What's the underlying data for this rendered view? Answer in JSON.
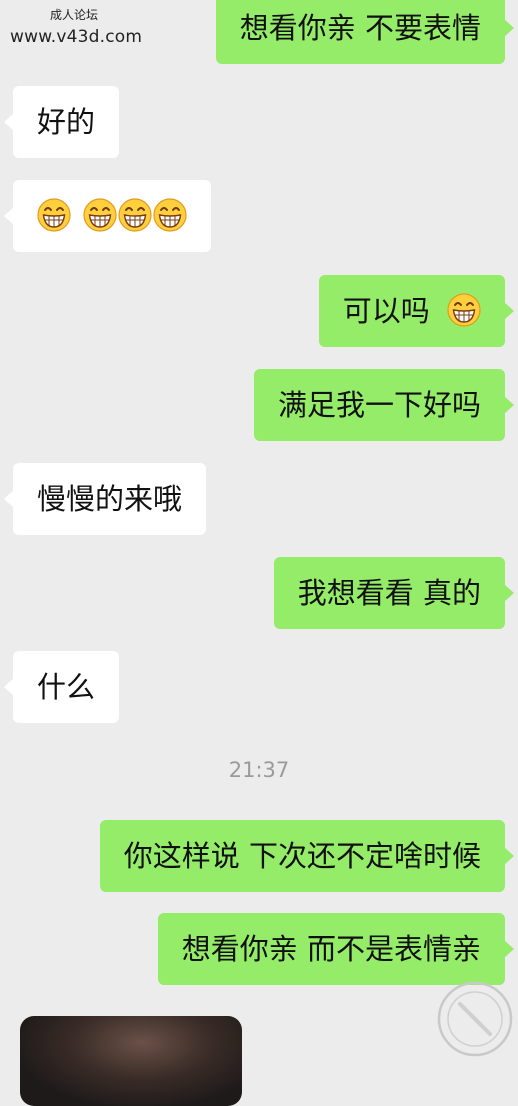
{
  "watermark": {
    "site_name": "成人论坛",
    "url": "www.v43d.com"
  },
  "messages": [
    {
      "side": "right",
      "text": "想看你亲 不要表情"
    },
    {
      "side": "left",
      "text": "好的"
    },
    {
      "side": "left",
      "emojis": [
        "grin-emoji",
        "grin-emoji",
        "grin-emoji",
        "grin-emoji"
      ]
    },
    {
      "side": "right",
      "text": "可以吗",
      "emojis": [
        "grin-emoji"
      ]
    },
    {
      "side": "right",
      "text": "满足我一下好吗"
    },
    {
      "side": "left",
      "text": "慢慢的来哦"
    },
    {
      "side": "right",
      "text": "我想看看 真的"
    },
    {
      "side": "left",
      "text": "什么"
    },
    {
      "side": "right",
      "text": "你这样说 下次还不定啥时候"
    },
    {
      "side": "right",
      "text": "想看你亲 而不是表情亲"
    }
  ],
  "timestamp": "21:37",
  "colors": {
    "sent_bubble": "#95ec69",
    "received_bubble": "#ffffff",
    "chat_background": "#ececec",
    "timestamp_text": "#9a9a9a"
  }
}
